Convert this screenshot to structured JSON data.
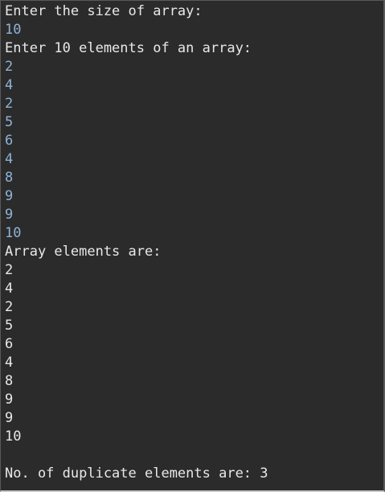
{
  "console": {
    "prompt_size": "Enter the size of array:",
    "input_size": "10",
    "prompt_elements": "Enter 10 elements of an array:",
    "input_elements": [
      "2",
      "4",
      "2",
      "5",
      "6",
      "4",
      "8",
      "9",
      "9",
      "10"
    ],
    "header_output": "Array elements are:",
    "output_elements": [
      "2",
      "4",
      "2",
      "5",
      "6",
      "4",
      "8",
      "9",
      "9",
      "10"
    ],
    "result": "No. of duplicate elements are: 3"
  },
  "colors": {
    "background": "#2b2b2b",
    "output_text": "#e8e8e8",
    "input_text": "#8fb3d6"
  }
}
